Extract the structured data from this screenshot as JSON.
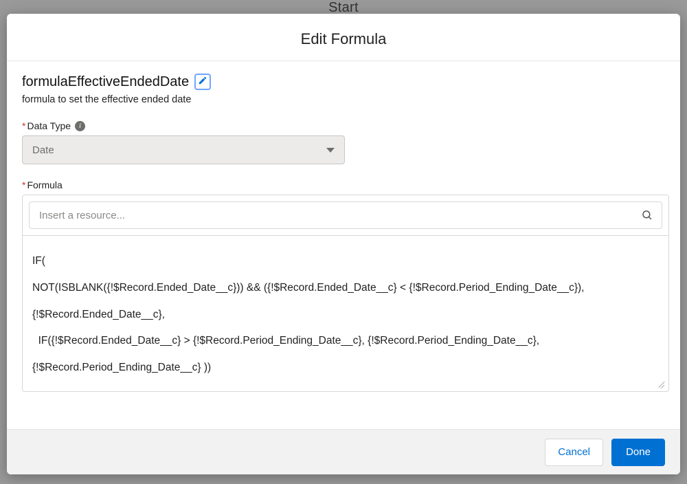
{
  "background": {
    "start_label": "Start"
  },
  "modal": {
    "title": "Edit Formula",
    "formula_name": "formulaEffectiveEndedDate",
    "description": "formula to set the effective ended date",
    "data_type_label": "Data Type",
    "data_type_value": "Date",
    "formula_label": "Formula",
    "resource_placeholder": "Insert a resource...",
    "formula_text": "IF(\nNOT(ISBLANK({!$Record.Ended_Date__c})) && ({!$Record.Ended_Date__c} < {!$Record.Period_Ending_Date__c}), {!$Record.Ended_Date__c},\n  IF({!$Record.Ended_Date__c} > {!$Record.Period_Ending_Date__c}, {!$Record.Period_Ending_Date__c}, {!$Record.Period_Ending_Date__c} ))",
    "footer": {
      "cancel": "Cancel",
      "done": "Done"
    },
    "required_marker": "*"
  }
}
